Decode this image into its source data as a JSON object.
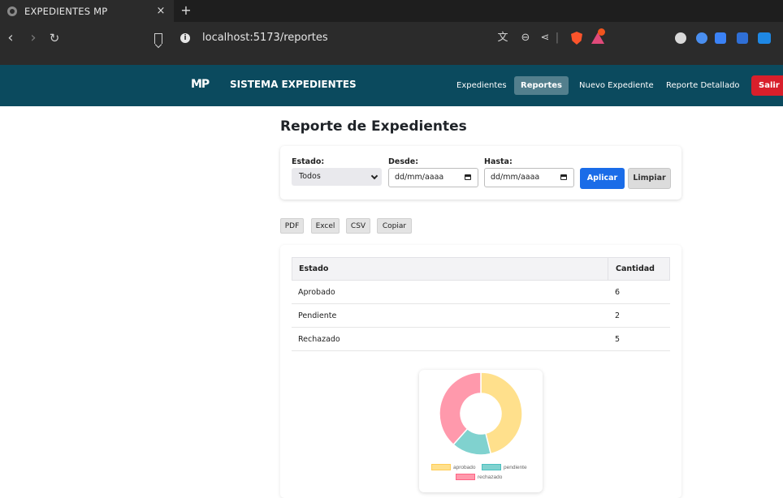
{
  "browser": {
    "tab_title": "EXPEDIENTES MP",
    "tab_close": "×",
    "new_tab": "+",
    "url": "localhost:5173/reportes",
    "info_glyph": "i"
  },
  "app": {
    "logo": "MP",
    "name": "SISTEMA EXPEDIENTES",
    "nav": [
      "Expedientes",
      "Reportes",
      "Nuevo Expediente",
      "Reporte Detallado"
    ],
    "active_nav": "Reportes",
    "logout": "Salir"
  },
  "page": {
    "title": "Reporte de Expedientes"
  },
  "filters": {
    "estado_label": "Estado:",
    "estado_value": "Todos",
    "desde_label": "Desde:",
    "desde_placeholder": "dd/mm/aaaa",
    "hasta_label": "Hasta:",
    "hasta_placeholder": "dd/mm/aaaa",
    "apply": "Aplicar",
    "clear": "Limpiar"
  },
  "exports": [
    "PDF",
    "Excel",
    "CSV",
    "Copiar"
  ],
  "table": {
    "headers": [
      "Estado",
      "Cantidad"
    ],
    "rows": [
      [
        "Aprobado",
        "6"
      ],
      [
        "Pendiente",
        "2"
      ],
      [
        "Rechazado",
        "5"
      ]
    ]
  },
  "chart_data": {
    "type": "pie",
    "variant": "doughnut",
    "labels": [
      "aprobado",
      "pendiente",
      "rechazado"
    ],
    "values": [
      6,
      2,
      5
    ],
    "colors": [
      "#ffe08c",
      "#80d2cf",
      "#ff99ac"
    ],
    "border_colors": [
      "#ffcd56",
      "#4bc0c0",
      "#ff6384"
    ],
    "legend_position": "bottom"
  }
}
